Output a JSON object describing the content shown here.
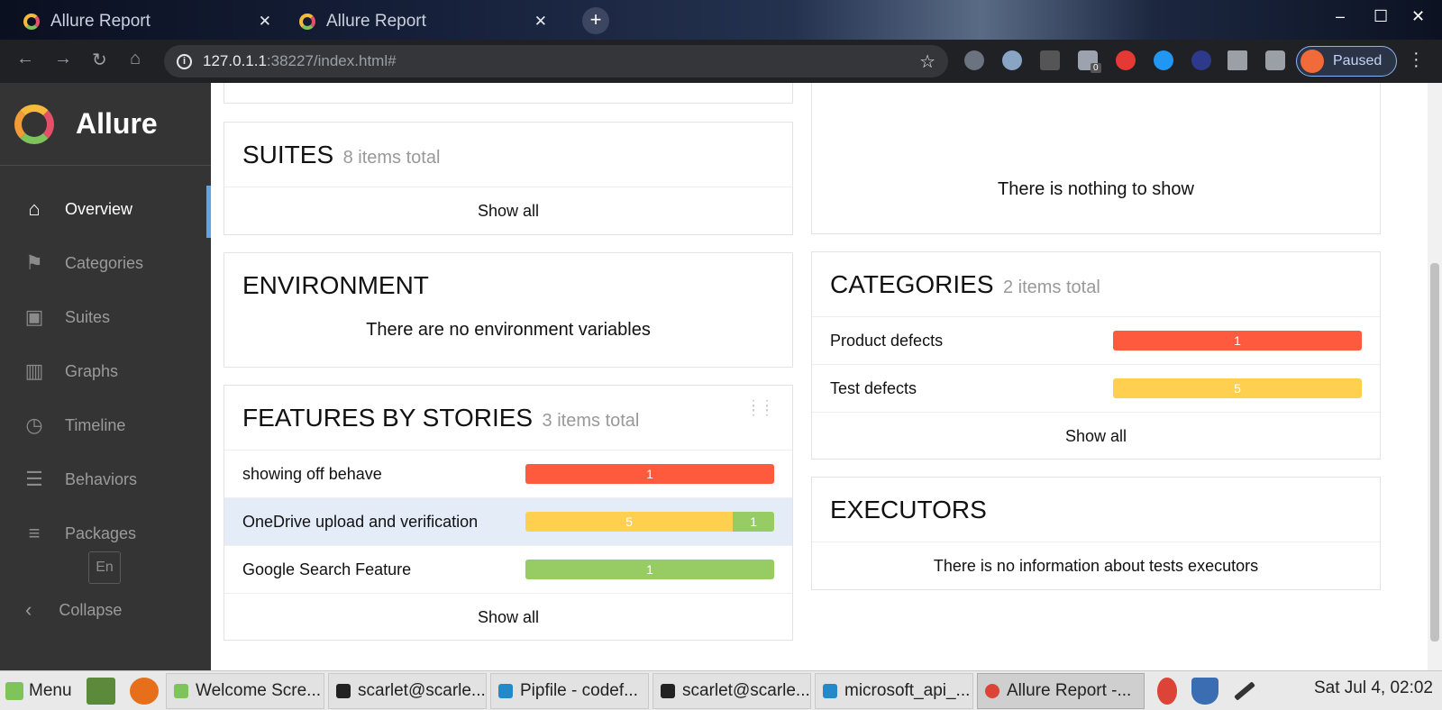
{
  "browser": {
    "tabs": [
      {
        "title": "Allure Report",
        "close": "✕"
      },
      {
        "title": "Allure Report",
        "close": "✕"
      }
    ],
    "new_tab": "+",
    "window_controls": [
      "–",
      "☐",
      "✕"
    ],
    "url_host": "127.0.1.1",
    "url_rest": ":38227/index.html#",
    "profile_status": "Paused",
    "extension_badge": "0"
  },
  "sidebar": {
    "brand": "Allure",
    "items": [
      {
        "label": "Overview",
        "icon": "home-icon",
        "active": true
      },
      {
        "label": "Categories",
        "icon": "flag-icon"
      },
      {
        "label": "Suites",
        "icon": "briefcase-icon"
      },
      {
        "label": "Graphs",
        "icon": "bar-chart-icon"
      },
      {
        "label": "Timeline",
        "icon": "clock-icon"
      },
      {
        "label": "Behaviors",
        "icon": "list-icon"
      },
      {
        "label": "Packages",
        "icon": "align-left-icon"
      }
    ],
    "language": "En",
    "collapse": "Collapse"
  },
  "suites": {
    "title": "SUITES",
    "count": "8 items total",
    "show_all": "Show all"
  },
  "environment": {
    "title": "ENVIRONMENT",
    "empty": "There are no environment variables"
  },
  "features": {
    "title": "FEATURES BY STORIES",
    "count": "3 items total",
    "rows": [
      {
        "label": "showing off behave",
        "failed": 1,
        "broken": 0,
        "passed": 0
      },
      {
        "label": "OneDrive upload and verification",
        "failed": 0,
        "broken": 5,
        "passed": 1
      },
      {
        "label": "Google Search Feature",
        "failed": 0,
        "broken": 0,
        "passed": 1
      }
    ],
    "show_all": "Show all"
  },
  "trend": {
    "empty": "There is nothing to show"
  },
  "categories": {
    "title": "CATEGORIES",
    "count": "2 items total",
    "rows": [
      {
        "label": "Product defects",
        "value": "1",
        "status": "failed"
      },
      {
        "label": "Test defects",
        "value": "5",
        "status": "broken"
      }
    ],
    "show_all": "Show all"
  },
  "executors": {
    "title": "EXECUTORS",
    "empty": "There is no information about tests executors"
  },
  "colors": {
    "failed": "#fd5a3e",
    "broken": "#ffd050",
    "passed": "#97cc64",
    "accent": "#5aa6e6"
  },
  "taskbar": {
    "menu": "Menu",
    "tasks": [
      {
        "label": "Welcome Scre..."
      },
      {
        "label": "scarlet@scarle..."
      },
      {
        "label": "Pipfile - codef..."
      },
      {
        "label": "scarlet@scarle..."
      },
      {
        "label": "microsoft_api_..."
      },
      {
        "label": "Allure Report -..."
      }
    ],
    "clock": "Sat Jul  4, 02:02"
  }
}
